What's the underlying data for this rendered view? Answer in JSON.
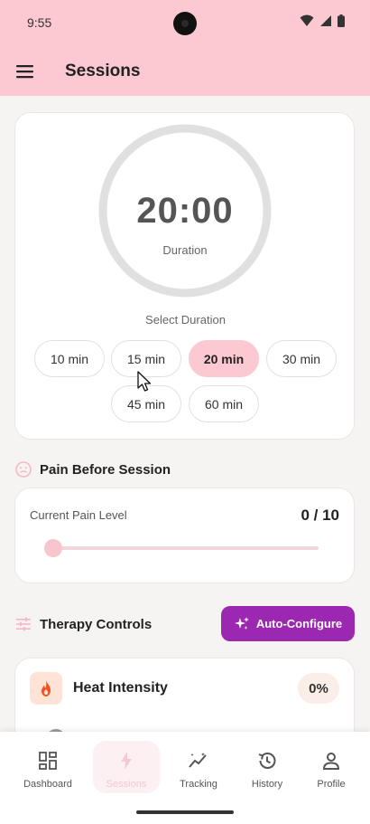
{
  "status_bar": {
    "time": "9:55"
  },
  "app_bar": {
    "title": "Sessions"
  },
  "timer": {
    "time": "20:00",
    "label": "Duration",
    "select_label": "Select Duration",
    "options": [
      "10 min",
      "15 min",
      "20 min",
      "30 min",
      "45 min",
      "60 min"
    ],
    "selected": "20 min"
  },
  "pain": {
    "section_title": "Pain Before Session",
    "current_label": "Current Pain Level",
    "value_text": "0 / 10",
    "level": 0,
    "max": 10
  },
  "therapy": {
    "section_title": "Therapy Controls",
    "auto_configure_label": "Auto-Configure",
    "heat": {
      "title": "Heat Intensity",
      "value": "0%"
    }
  },
  "nav": {
    "items": [
      {
        "label": "Dashboard",
        "icon": "dashboard-icon"
      },
      {
        "label": "Sessions",
        "icon": "bolt-icon"
      },
      {
        "label": "Tracking",
        "icon": "trending-icon"
      },
      {
        "label": "History",
        "icon": "history-icon"
      },
      {
        "label": "Profile",
        "icon": "person-icon"
      }
    ],
    "active": "Sessions"
  },
  "colors": {
    "accent_pink": "#fcc8d1",
    "purple": "#9c27b0",
    "heat_orange": "#f4511e"
  }
}
